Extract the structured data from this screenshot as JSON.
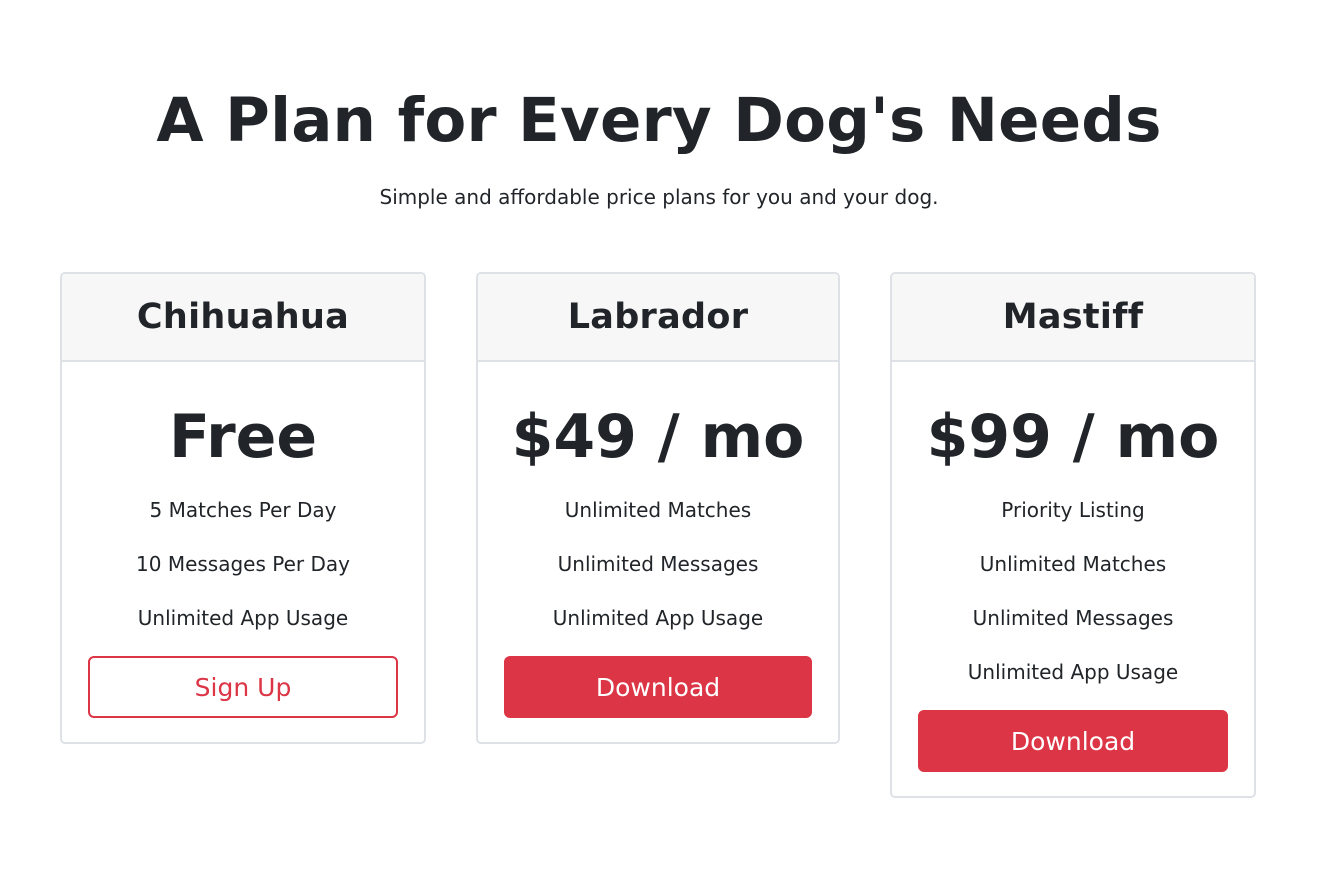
{
  "page": {
    "headline": "A Plan for Every Dog's Needs",
    "subheadline": "Simple and affordable price plans for you and your dog."
  },
  "plans": [
    {
      "name": "Chihuahua",
      "price": "Free",
      "features": [
        "5 Matches Per Day",
        "10 Messages Per Day",
        "Unlimited App Usage"
      ],
      "cta": "Sign Up"
    },
    {
      "name": "Labrador",
      "price": "$49 / mo",
      "features": [
        "Unlimited Matches",
        "Unlimited Messages",
        "Unlimited App Usage"
      ],
      "cta": "Download"
    },
    {
      "name": "Mastiff",
      "price": "$99 / mo",
      "features": [
        "Priority Listing",
        "Unlimited Matches",
        "Unlimited Messages",
        "Unlimited App Usage"
      ],
      "cta": "Download"
    }
  ],
  "colors": {
    "accent": "#dc3545",
    "text": "#212529",
    "header_bg": "#f7f7f7",
    "border": "#dee2e6"
  }
}
